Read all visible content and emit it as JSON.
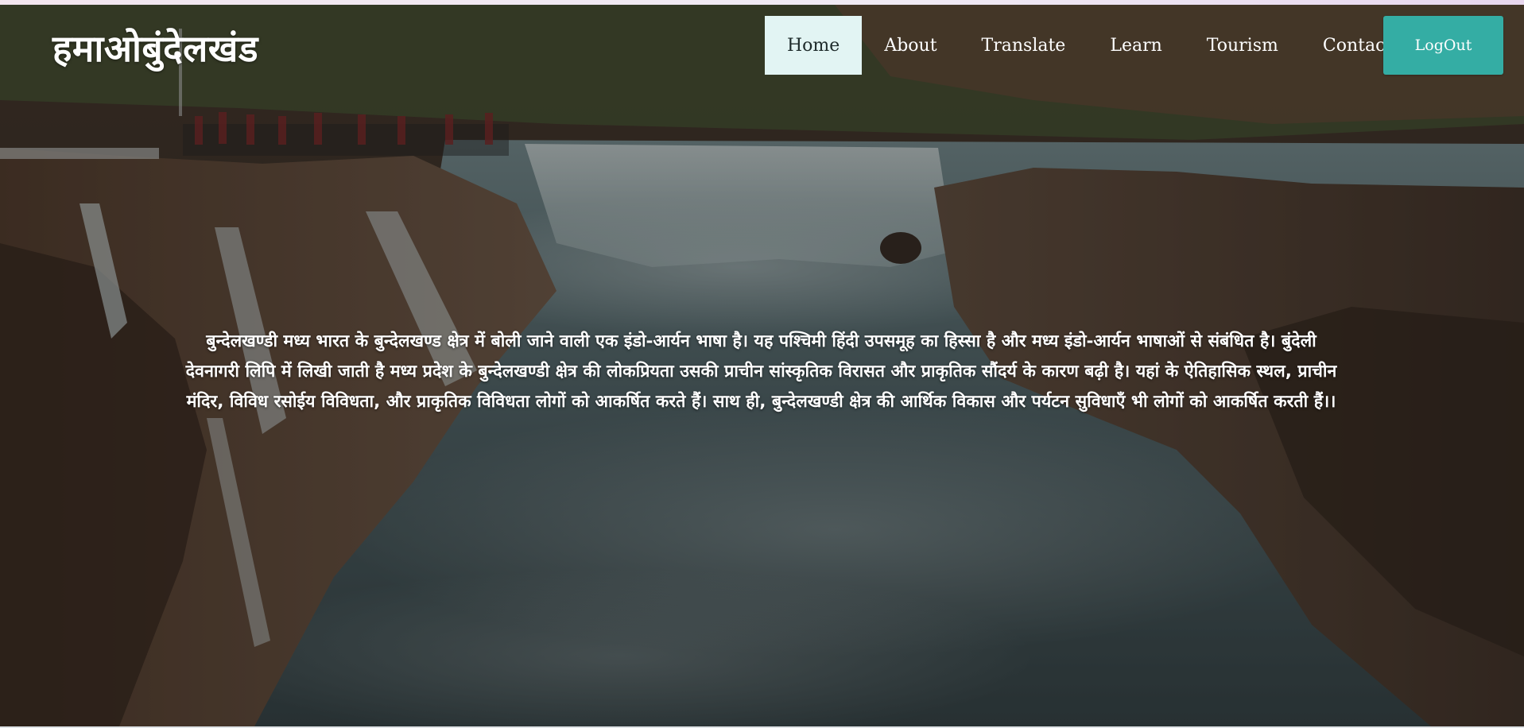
{
  "brand": {
    "title": "हमाओबुंदेलखंड"
  },
  "nav": {
    "items": [
      {
        "label": "Home",
        "active": true
      },
      {
        "label": "About",
        "active": false
      },
      {
        "label": "Translate",
        "active": false
      },
      {
        "label": "Learn",
        "active": false
      },
      {
        "label": "Tourism",
        "active": false
      },
      {
        "label": "Contact",
        "active": false
      }
    ],
    "logout_label": "LogOut"
  },
  "hero": {
    "description": "बुन्देलखण्डी मध्य भारत के बुन्देलखण्ड क्षेत्र में बोली जाने वाली एक इंडो-आर्यन भाषा है। यह पश्चिमी हिंदी उपसमूह का हिस्सा है और मध्य इंडो-आर्यन भाषाओं से संबंधित है। बुंदेली देवनागरी लिपि में लिखी जाती है मध्य प्रदेश के बुन्देलखण्डी क्षेत्र की लोकप्रियता उसकी प्राचीन सांस्कृतिक विरासत और प्राकृतिक सौंदर्य के कारण बढ़ी है। यहां के ऐतिहासिक स्थल, प्राचीन मंदिर, विविध रसोईय विविधता, और प्राकृतिक विविधता लोगों को आकर्षित करते हैं। साथ ही, बुन्देलखण्डी क्षेत्र की आर्थिक विकास और पर्यटन सुविधाएँ भी लोगों को आकर्षित करती हैं।।"
  },
  "colors": {
    "active_nav_bg": "#e2f4f3",
    "logout_bg": "#34ada4",
    "text_light": "#ffffff"
  }
}
